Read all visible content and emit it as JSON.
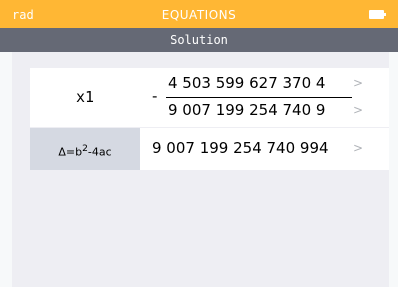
{
  "status_bar": {
    "angle_mode": "rad",
    "app_title": "EQUATIONS",
    "battery_icon": "battery-icon"
  },
  "sub_header": {
    "title": "Solution"
  },
  "results": [
    {
      "label": "x1",
      "sign": "-",
      "numerator": "4 503 599 627 370 4",
      "denominator": "9 007 199 254 740 9"
    },
    {
      "label_base": "Δ=b",
      "label_sup": "2",
      "label_tail": "-4ac",
      "value": "9 007 199 254 740 994"
    }
  ],
  "colors": {
    "status_bar": "#ffb734",
    "sub_header": "#656975",
    "label_cell": "#d5d9e2"
  }
}
